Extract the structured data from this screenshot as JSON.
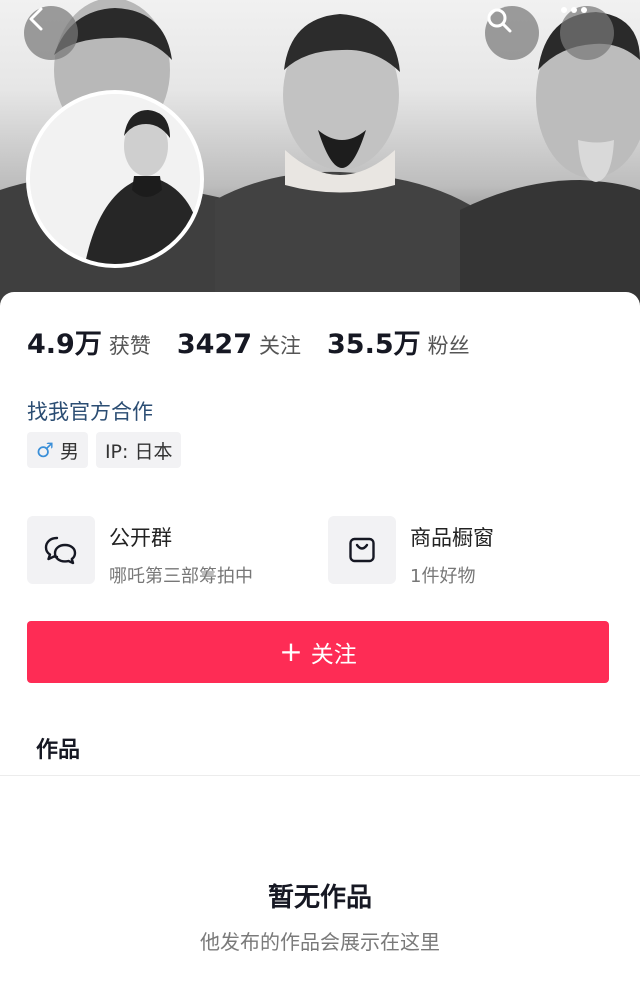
{
  "header": {
    "back_icon": "chevron-left-icon",
    "search_icon": "search-icon",
    "more_icon": "more-dots-icon"
  },
  "stats": [
    {
      "value": "4.9万",
      "label": "获赞"
    },
    {
      "value": "3427",
      "label": "关注"
    },
    {
      "value": "35.5万",
      "label": "粉丝"
    }
  ],
  "profile": {
    "cooperation_link": "找我官方合作",
    "gender_symbol": "♂",
    "gender_label": "男",
    "ip_label": "IP: 日本"
  },
  "features": {
    "group": {
      "icon": "chat-bubbles-icon",
      "title": "公开群",
      "subtitle": "哪吒第三部筹拍中"
    },
    "shop": {
      "icon": "shopping-bag-icon",
      "title": "商品橱窗",
      "subtitle": "1件好物"
    }
  },
  "follow_button": {
    "plus": "+",
    "label": "关注"
  },
  "tabs": {
    "works": "作品"
  },
  "empty_state": {
    "title": "暂无作品",
    "subtitle": "他发布的作品会展示在这里"
  },
  "colors": {
    "accent": "#fe2c55",
    "link": "#2b4d73",
    "male": "#3a8fd8"
  }
}
